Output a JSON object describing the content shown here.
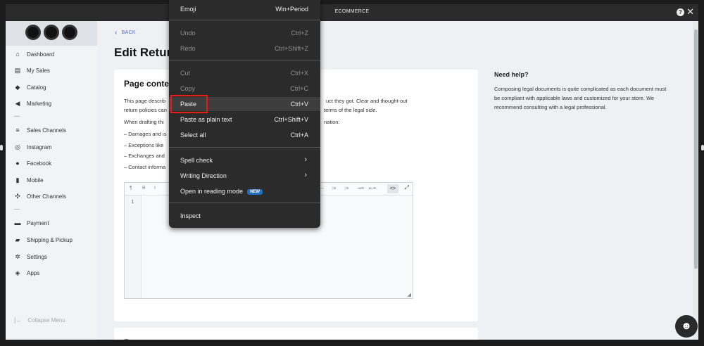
{
  "window": {
    "title": "ECOMMERCE"
  },
  "sidebar": {
    "items": [
      {
        "label": "Dashboard",
        "icon": "home-icon"
      },
      {
        "label": "My Sales",
        "icon": "sales-icon"
      },
      {
        "label": "Catalog",
        "icon": "tag-icon"
      },
      {
        "label": "Marketing",
        "icon": "megaphone-icon"
      },
      {
        "label": "Sales Channels",
        "icon": "stack-icon"
      },
      {
        "label": "Instagram",
        "icon": "instagram-icon"
      },
      {
        "label": "Facebook",
        "icon": "facebook-icon"
      },
      {
        "label": "Mobile",
        "icon": "mobile-icon"
      },
      {
        "label": "Other Channels",
        "icon": "network-icon"
      },
      {
        "label": "Payment",
        "icon": "payment-icon"
      },
      {
        "label": "Shipping & Pickup",
        "icon": "truck-icon"
      },
      {
        "label": "Settings",
        "icon": "gear-icon"
      },
      {
        "label": "Apps",
        "icon": "apps-icon"
      }
    ],
    "collapse_label": "Collapse Menu"
  },
  "main": {
    "back_label": "BACK",
    "page_title": "Edit Retur",
    "card": {
      "title": "Page conten",
      "lines": [
        "This page describ",
        "return policies can",
        "When drafting thi",
        "– Damages and is",
        "– Exceptions like",
        "– Exchanges and",
        "– Contact informa"
      ],
      "lines_right": [
        "uct they got. Clear and thought-out",
        "terms of the legal side.",
        "nation:"
      ],
      "editor": {
        "line_number": "1"
      }
    },
    "card2_title": "P"
  },
  "help": {
    "title": "Need help?",
    "text": "Composing legal documents is quite complicated as each document must be compliant with applicable laws and customized for your store. We recommend consulting with a legal professional."
  },
  "context_menu": {
    "items": [
      {
        "label": "Emoji",
        "shortcut": "Win+Period",
        "enabled": true
      },
      {
        "label": "Undo",
        "shortcut": "Ctrl+Z",
        "enabled": false
      },
      {
        "label": "Redo",
        "shortcut": "Ctrl+Shift+Z",
        "enabled": false
      },
      {
        "label": "Cut",
        "shortcut": "Ctrl+X",
        "enabled": false
      },
      {
        "label": "Copy",
        "shortcut": "Ctrl+C",
        "enabled": false
      },
      {
        "label": "Paste",
        "shortcut": "Ctrl+V",
        "enabled": true,
        "highlighted": true
      },
      {
        "label": "Paste as plain text",
        "shortcut": "Ctrl+Shift+V",
        "enabled": true
      },
      {
        "label": "Select all",
        "shortcut": "Ctrl+A",
        "enabled": true
      },
      {
        "label": "Spell check",
        "shortcut": "",
        "enabled": true,
        "submenu": true
      },
      {
        "label": "Writing Direction",
        "shortcut": "",
        "enabled": true,
        "submenu": true
      },
      {
        "label": "Open in reading mode",
        "shortcut": "",
        "enabled": true,
        "badge": "NEW"
      },
      {
        "label": "Inspect",
        "shortcut": "",
        "enabled": true
      }
    ]
  },
  "colors": {
    "accent": "#4a6fc0",
    "highlight_box": "#e81b1b",
    "badge": "#1f6fbf",
    "menu_bg": "#2b2b2b"
  }
}
